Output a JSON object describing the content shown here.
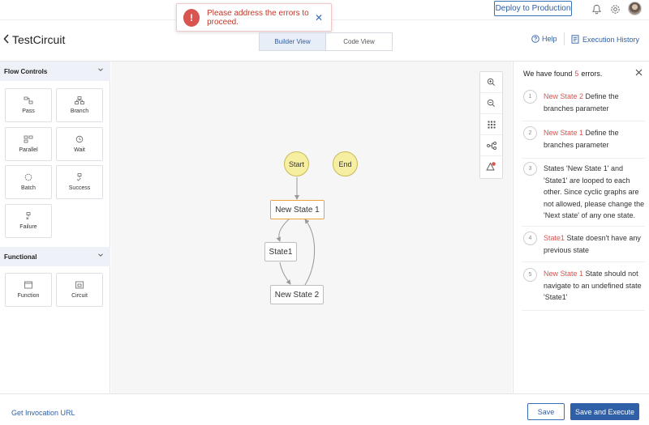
{
  "topbar": {
    "deploy_label": "Deploy to Production"
  },
  "toast": {
    "message": "Please address the errors to proceed.",
    "icon_glyph": "!",
    "close_glyph": "✕"
  },
  "header": {
    "title": "TestCircuit",
    "back_glyph": "<",
    "tabs": [
      {
        "label": "Builder View",
        "active": true
      },
      {
        "label": "Code View",
        "active": false
      }
    ],
    "help_label": "Help",
    "history_label": "Execution History"
  },
  "sidebar": {
    "flow_controls": {
      "title": "Flow Controls",
      "items": [
        {
          "label": "Pass",
          "icon": "pass-icon"
        },
        {
          "label": "Branch",
          "icon": "branch-icon"
        },
        {
          "label": "Parallel",
          "icon": "parallel-icon"
        },
        {
          "label": "Wait",
          "icon": "wait-icon"
        },
        {
          "label": "Batch",
          "icon": "batch-icon"
        },
        {
          "label": "Success",
          "icon": "success-icon"
        },
        {
          "label": "Failure",
          "icon": "failure-icon"
        }
      ]
    },
    "functional": {
      "title": "Functional",
      "items": [
        {
          "label": "Function",
          "icon": "function-icon"
        },
        {
          "label": "Circuit",
          "icon": "circuit-icon"
        }
      ]
    }
  },
  "canvas": {
    "nodes": {
      "start": "Start",
      "end": "End",
      "new_state_1": "New State 1",
      "state1": "State1",
      "new_state_2": "New State 2"
    }
  },
  "errors": {
    "prefix": "We have found",
    "count": "5",
    "suffix": "errors.",
    "items": [
      {
        "num": "1",
        "state": "New State 2",
        "text": "Define the branches parameter"
      },
      {
        "num": "2",
        "state": "New State 1",
        "text": "Define the branches parameter"
      },
      {
        "num": "3",
        "state": "",
        "text": "States 'New State 1' and 'State1' are looped to each other. Since cyclic graphs are not allowed, please change the 'Next state' of any one state."
      },
      {
        "num": "4",
        "state": "State1",
        "text": "State doesn't have any previous state"
      },
      {
        "num": "5",
        "state": "New State 1",
        "text": "State should not navigate to an undefined state 'State1'"
      }
    ]
  },
  "footer": {
    "invocation_label": "Get Invocation URL",
    "save_label": "Save",
    "save_execute_label": "Save and Execute"
  },
  "colors": {
    "accent": "#2f5fa7",
    "error": "#d9534f",
    "start_node": "#f6eea0",
    "selected_node": "#e8a33a"
  }
}
